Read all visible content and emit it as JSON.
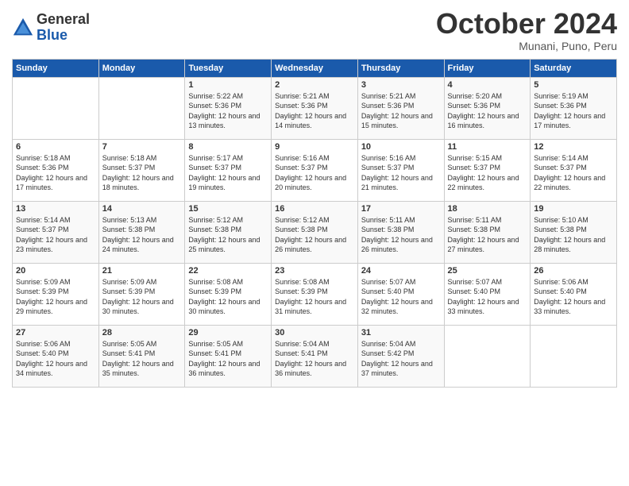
{
  "header": {
    "logo_general": "General",
    "logo_blue": "Blue",
    "month_title": "October 2024",
    "location": "Munani, Puno, Peru"
  },
  "weekdays": [
    "Sunday",
    "Monday",
    "Tuesday",
    "Wednesday",
    "Thursday",
    "Friday",
    "Saturday"
  ],
  "weeks": [
    [
      {
        "day": "",
        "sunrise": "",
        "sunset": "",
        "daylight": ""
      },
      {
        "day": "",
        "sunrise": "",
        "sunset": "",
        "daylight": ""
      },
      {
        "day": "1",
        "sunrise": "Sunrise: 5:22 AM",
        "sunset": "Sunset: 5:36 PM",
        "daylight": "Daylight: 12 hours and 13 minutes."
      },
      {
        "day": "2",
        "sunrise": "Sunrise: 5:21 AM",
        "sunset": "Sunset: 5:36 PM",
        "daylight": "Daylight: 12 hours and 14 minutes."
      },
      {
        "day": "3",
        "sunrise": "Sunrise: 5:21 AM",
        "sunset": "Sunset: 5:36 PM",
        "daylight": "Daylight: 12 hours and 15 minutes."
      },
      {
        "day": "4",
        "sunrise": "Sunrise: 5:20 AM",
        "sunset": "Sunset: 5:36 PM",
        "daylight": "Daylight: 12 hours and 16 minutes."
      },
      {
        "day": "5",
        "sunrise": "Sunrise: 5:19 AM",
        "sunset": "Sunset: 5:36 PM",
        "daylight": "Daylight: 12 hours and 17 minutes."
      }
    ],
    [
      {
        "day": "6",
        "sunrise": "Sunrise: 5:18 AM",
        "sunset": "Sunset: 5:36 PM",
        "daylight": "Daylight: 12 hours and 17 minutes."
      },
      {
        "day": "7",
        "sunrise": "Sunrise: 5:18 AM",
        "sunset": "Sunset: 5:37 PM",
        "daylight": "Daylight: 12 hours and 18 minutes."
      },
      {
        "day": "8",
        "sunrise": "Sunrise: 5:17 AM",
        "sunset": "Sunset: 5:37 PM",
        "daylight": "Daylight: 12 hours and 19 minutes."
      },
      {
        "day": "9",
        "sunrise": "Sunrise: 5:16 AM",
        "sunset": "Sunset: 5:37 PM",
        "daylight": "Daylight: 12 hours and 20 minutes."
      },
      {
        "day": "10",
        "sunrise": "Sunrise: 5:16 AM",
        "sunset": "Sunset: 5:37 PM",
        "daylight": "Daylight: 12 hours and 21 minutes."
      },
      {
        "day": "11",
        "sunrise": "Sunrise: 5:15 AM",
        "sunset": "Sunset: 5:37 PM",
        "daylight": "Daylight: 12 hours and 22 minutes."
      },
      {
        "day": "12",
        "sunrise": "Sunrise: 5:14 AM",
        "sunset": "Sunset: 5:37 PM",
        "daylight": "Daylight: 12 hours and 22 minutes."
      }
    ],
    [
      {
        "day": "13",
        "sunrise": "Sunrise: 5:14 AM",
        "sunset": "Sunset: 5:37 PM",
        "daylight": "Daylight: 12 hours and 23 minutes."
      },
      {
        "day": "14",
        "sunrise": "Sunrise: 5:13 AM",
        "sunset": "Sunset: 5:38 PM",
        "daylight": "Daylight: 12 hours and 24 minutes."
      },
      {
        "day": "15",
        "sunrise": "Sunrise: 5:12 AM",
        "sunset": "Sunset: 5:38 PM",
        "daylight": "Daylight: 12 hours and 25 minutes."
      },
      {
        "day": "16",
        "sunrise": "Sunrise: 5:12 AM",
        "sunset": "Sunset: 5:38 PM",
        "daylight": "Daylight: 12 hours and 26 minutes."
      },
      {
        "day": "17",
        "sunrise": "Sunrise: 5:11 AM",
        "sunset": "Sunset: 5:38 PM",
        "daylight": "Daylight: 12 hours and 26 minutes."
      },
      {
        "day": "18",
        "sunrise": "Sunrise: 5:11 AM",
        "sunset": "Sunset: 5:38 PM",
        "daylight": "Daylight: 12 hours and 27 minutes."
      },
      {
        "day": "19",
        "sunrise": "Sunrise: 5:10 AM",
        "sunset": "Sunset: 5:38 PM",
        "daylight": "Daylight: 12 hours and 28 minutes."
      }
    ],
    [
      {
        "day": "20",
        "sunrise": "Sunrise: 5:09 AM",
        "sunset": "Sunset: 5:39 PM",
        "daylight": "Daylight: 12 hours and 29 minutes."
      },
      {
        "day": "21",
        "sunrise": "Sunrise: 5:09 AM",
        "sunset": "Sunset: 5:39 PM",
        "daylight": "Daylight: 12 hours and 30 minutes."
      },
      {
        "day": "22",
        "sunrise": "Sunrise: 5:08 AM",
        "sunset": "Sunset: 5:39 PM",
        "daylight": "Daylight: 12 hours and 30 minutes."
      },
      {
        "day": "23",
        "sunrise": "Sunrise: 5:08 AM",
        "sunset": "Sunset: 5:39 PM",
        "daylight": "Daylight: 12 hours and 31 minutes."
      },
      {
        "day": "24",
        "sunrise": "Sunrise: 5:07 AM",
        "sunset": "Sunset: 5:40 PM",
        "daylight": "Daylight: 12 hours and 32 minutes."
      },
      {
        "day": "25",
        "sunrise": "Sunrise: 5:07 AM",
        "sunset": "Sunset: 5:40 PM",
        "daylight": "Daylight: 12 hours and 33 minutes."
      },
      {
        "day": "26",
        "sunrise": "Sunrise: 5:06 AM",
        "sunset": "Sunset: 5:40 PM",
        "daylight": "Daylight: 12 hours and 33 minutes."
      }
    ],
    [
      {
        "day": "27",
        "sunrise": "Sunrise: 5:06 AM",
        "sunset": "Sunset: 5:40 PM",
        "daylight": "Daylight: 12 hours and 34 minutes."
      },
      {
        "day": "28",
        "sunrise": "Sunrise: 5:05 AM",
        "sunset": "Sunset: 5:41 PM",
        "daylight": "Daylight: 12 hours and 35 minutes."
      },
      {
        "day": "29",
        "sunrise": "Sunrise: 5:05 AM",
        "sunset": "Sunset: 5:41 PM",
        "daylight": "Daylight: 12 hours and 36 minutes."
      },
      {
        "day": "30",
        "sunrise": "Sunrise: 5:04 AM",
        "sunset": "Sunset: 5:41 PM",
        "daylight": "Daylight: 12 hours and 36 minutes."
      },
      {
        "day": "31",
        "sunrise": "Sunrise: 5:04 AM",
        "sunset": "Sunset: 5:42 PM",
        "daylight": "Daylight: 12 hours and 37 minutes."
      },
      {
        "day": "",
        "sunrise": "",
        "sunset": "",
        "daylight": ""
      },
      {
        "day": "",
        "sunrise": "",
        "sunset": "",
        "daylight": ""
      }
    ]
  ]
}
